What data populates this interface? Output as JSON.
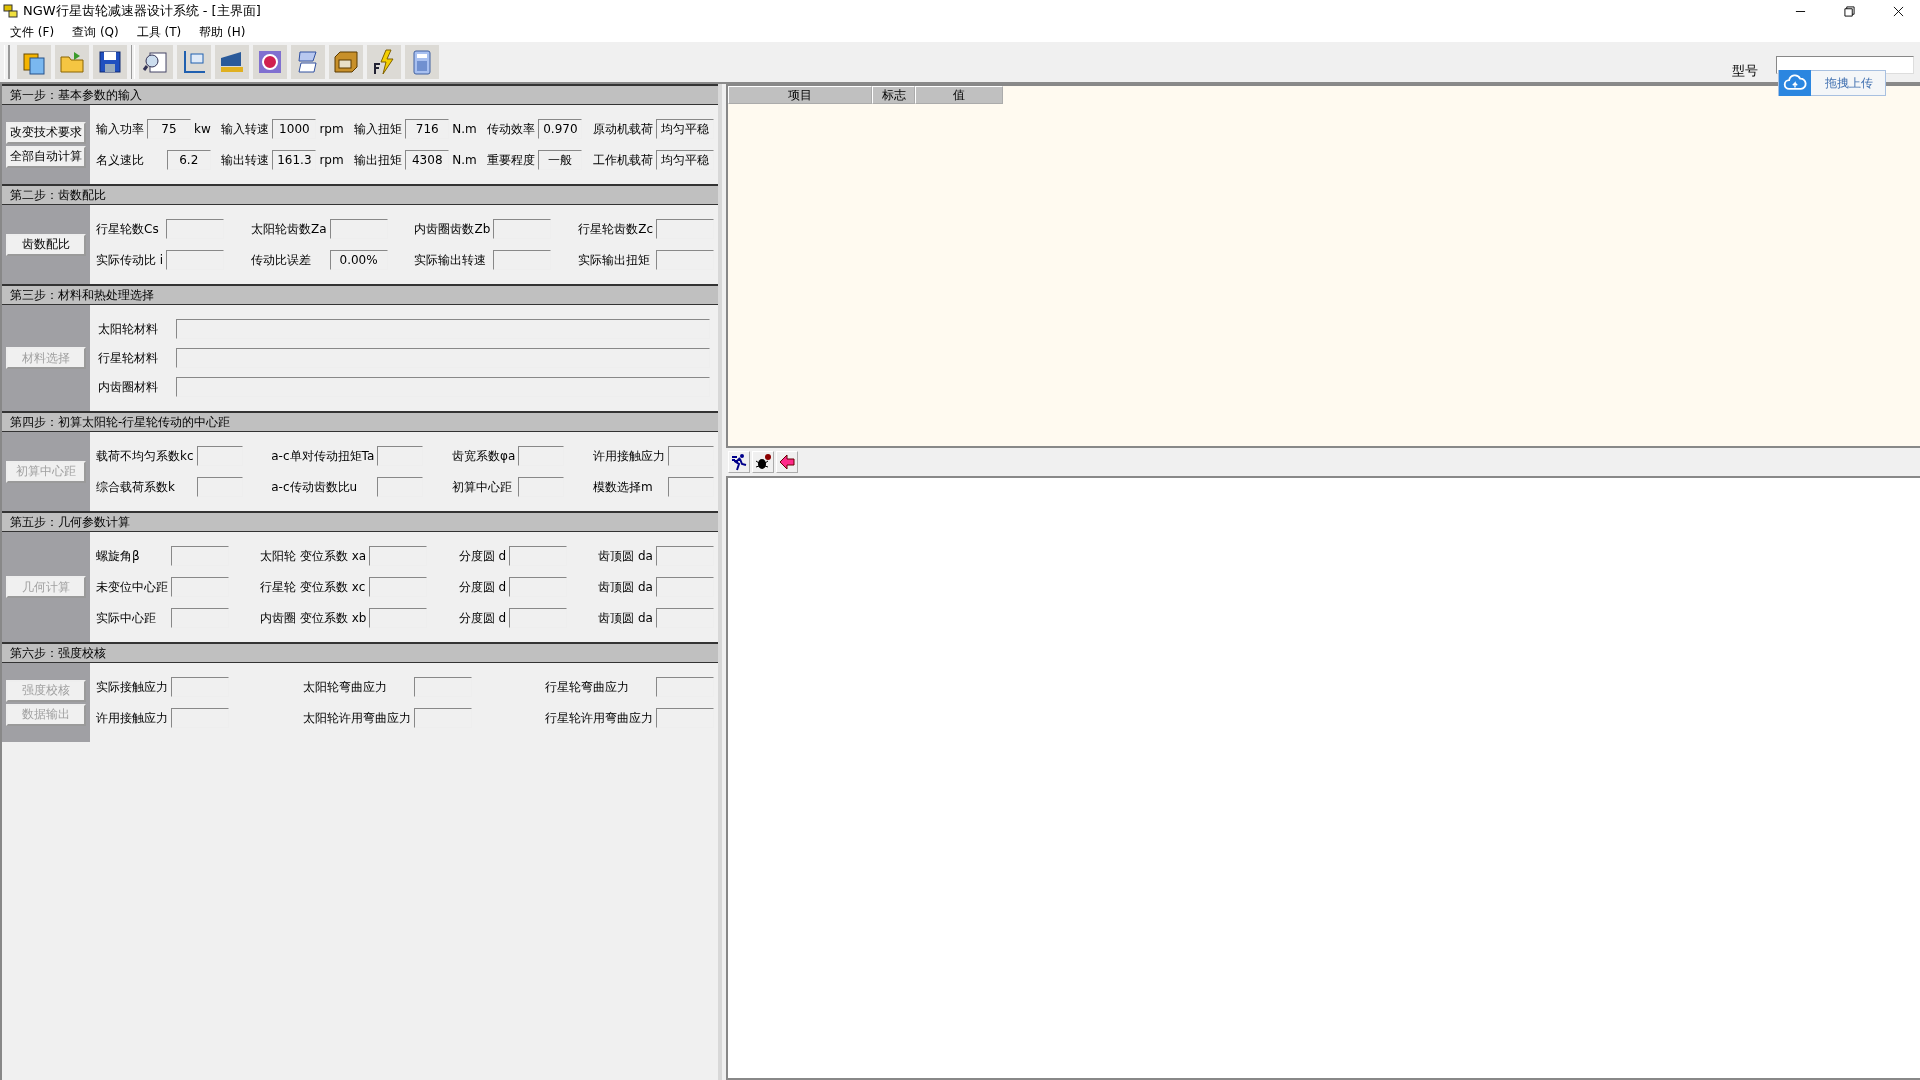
{
  "window": {
    "title": "NGW行星齿轮减速器设计系统 - [主界面]"
  },
  "menu": [
    "文件 (F)",
    "查询 (Q)",
    "工具 (T)",
    "帮助 (H)"
  ],
  "model": {
    "label": "型号"
  },
  "upload": {
    "label": "拖拽上传"
  },
  "steps": [
    {
      "title": "第一步：基本参数的输入",
      "kind": "grid",
      "buttons": [
        {
          "label": "改变技术要求",
          "disabled": false
        },
        {
          "label": "全部自动计算",
          "disabled": false
        }
      ],
      "rows": [
        [
          {
            "label": "输入功率",
            "value": "75",
            "unit": "kw"
          },
          {
            "label": "输入转速",
            "value": "1000",
            "unit": "rpm"
          },
          {
            "label": "输入扭矩",
            "value": "716",
            "unit": "N.m"
          },
          {
            "label": "传动效率",
            "value": "0.970"
          },
          {
            "label": "原动机载荷",
            "value": "均匀平稳"
          }
        ],
        [
          {
            "label": "名义速比",
            "value": "6.2"
          },
          {
            "label": "输出转速",
            "value": "161.3",
            "unit": "rpm"
          },
          {
            "label": "输出扭矩",
            "value": "4308",
            "unit": "N.m"
          },
          {
            "label": "重要程度",
            "value": "一般"
          },
          {
            "label": "工作机载荷",
            "value": "均匀平稳"
          }
        ]
      ]
    },
    {
      "title": "第二步：齿数配比",
      "kind": "grid",
      "buttons": [
        {
          "label": "齿数配比",
          "disabled": false
        }
      ],
      "rows": [
        [
          {
            "label": "行星轮数Cs"
          },
          {
            "label": "太阳轮齿数Za"
          },
          {
            "label": "内齿圈齿数Zb"
          },
          {
            "label": "行星轮齿数Zc"
          }
        ],
        [
          {
            "label": "实际传动比 i"
          },
          {
            "label": "传动比误差",
            "value": "0.00%"
          },
          {
            "label": "实际输出转速"
          },
          {
            "label": "实际输出扭矩"
          }
        ]
      ]
    },
    {
      "title": "第三步：材料和热处理选择",
      "kind": "wide",
      "buttons": [
        {
          "label": "材料选择",
          "disabled": true
        }
      ],
      "rows": [
        [
          {
            "label": "太阳轮材料"
          }
        ],
        [
          {
            "label": "行星轮材料"
          }
        ],
        [
          {
            "label": "内齿圈材料"
          }
        ]
      ]
    },
    {
      "title": "第四步：初算太阳轮-行星轮传动的中心距",
      "kind": "grid",
      "buttons": [
        {
          "label": "初算中心距",
          "disabled": true
        }
      ],
      "rows": [
        [
          {
            "label": "载荷不均匀系数kc"
          },
          {
            "label": "a-c单对传动扭矩Ta"
          },
          {
            "label": "齿宽系数φa"
          },
          {
            "label": "许用接触应力"
          }
        ],
        [
          {
            "label": "综合载荷系数k"
          },
          {
            "label": "a-c传动齿数比u"
          },
          {
            "label": "初算中心距"
          },
          {
            "label": "模数选择m"
          }
        ]
      ]
    },
    {
      "title": "第五步：几何参数计算",
      "kind": "grid",
      "buttons": [
        {
          "label": "几何计算",
          "disabled": true
        }
      ],
      "rows": [
        [
          {
            "label": "螺旋角β"
          },
          {
            "label": "太阳轮 变位系数 xa"
          },
          {
            "label": "分度圆 d"
          },
          {
            "label": "齿顶圆 da"
          }
        ],
        [
          {
            "label": "未变位中心距"
          },
          {
            "label": "行星轮 变位系数 xc"
          },
          {
            "label": "分度圆 d"
          },
          {
            "label": "齿顶圆 da"
          }
        ],
        [
          {
            "label": "实际中心距"
          },
          {
            "label": "内齿圈 变位系数 xb"
          },
          {
            "label": "分度圆 d"
          },
          {
            "label": "齿顶圆 da"
          }
        ]
      ]
    },
    {
      "title": "第六步：强度校核",
      "kind": "grid",
      "buttons": [
        {
          "label": "强度校核",
          "disabled": true
        },
        {
          "label": "数据输出",
          "disabled": true
        }
      ],
      "rows": [
        [
          {
            "label": "实际接触应力"
          },
          {
            "label": "太阳轮弯曲应力"
          },
          {
            "label": "行星轮弯曲应力"
          }
        ],
        [
          {
            "label": "许用接触应力"
          },
          {
            "label": "太阳轮许用弯曲应力"
          },
          {
            "label": "行星轮许用弯曲应力"
          }
        ]
      ]
    }
  ],
  "result_table": {
    "columns": [
      "项目",
      "标志",
      "值"
    ]
  }
}
